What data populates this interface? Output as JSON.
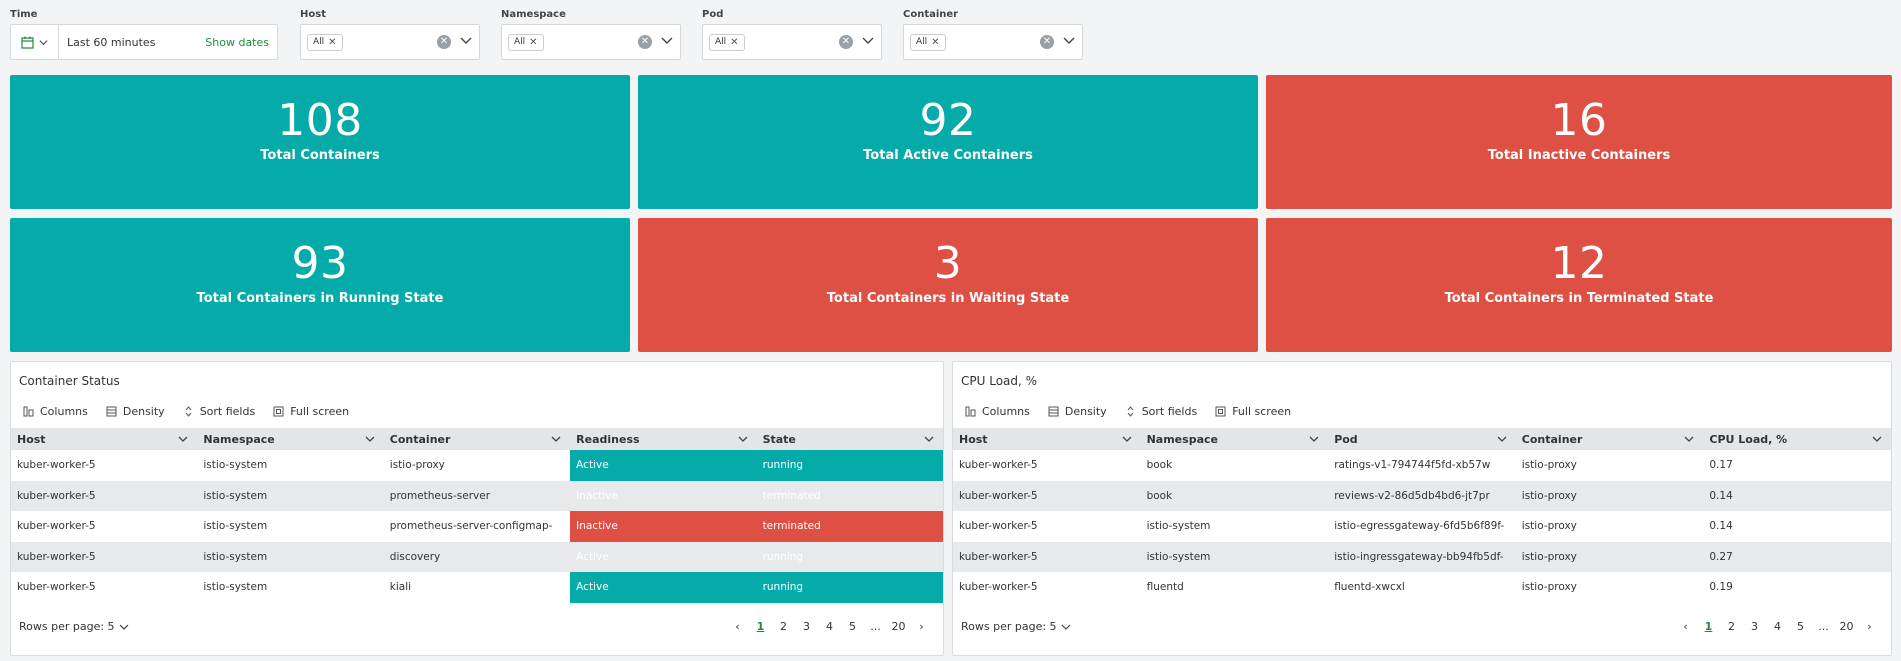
{
  "filters": {
    "time": {
      "label": "Time",
      "value": "Last 60 minutes",
      "action": "Show dates"
    },
    "host": {
      "label": "Host",
      "tag": "All"
    },
    "namespace": {
      "label": "Namespace",
      "tag": "All"
    },
    "pod": {
      "label": "Pod",
      "tag": "All"
    },
    "container": {
      "label": "Container",
      "tag": "All"
    }
  },
  "tiles": [
    {
      "value": "108",
      "label": "Total Containers",
      "color": "#05aba9"
    },
    {
      "value": "92",
      "label": "Total Active Containers",
      "color": "#05aba9"
    },
    {
      "value": "16",
      "label": "Total Inactive Containers",
      "color": "#de4f44"
    },
    {
      "value": "93",
      "label": "Total Containers in Running State",
      "color": "#05aba9"
    },
    {
      "value": "3",
      "label": "Total Containers in Waiting State",
      "color": "#de4f44"
    },
    {
      "value": "12",
      "label": "Total Containers in Terminated State",
      "color": "#de4f44"
    }
  ],
  "toolbar": {
    "columns": "Columns",
    "density": "Density",
    "sort": "Sort fields",
    "fullscreen": "Full screen"
  },
  "container_status": {
    "title": "Container Status",
    "columns": [
      "Host",
      "Namespace",
      "Container",
      "Readiness",
      "State"
    ],
    "rows": [
      [
        "kuber-worker-5",
        "istio-system",
        "istio-proxy",
        "Active",
        "running"
      ],
      [
        "kuber-worker-5",
        "istio-system",
        "prometheus-server",
        "Inactive",
        "terminated"
      ],
      [
        "kuber-worker-5",
        "istio-system",
        "prometheus-server-configmap-",
        "Inactive",
        "terminated"
      ],
      [
        "kuber-worker-5",
        "istio-system",
        "discovery",
        "Active",
        "running"
      ],
      [
        "kuber-worker-5",
        "istio-system",
        "kiali",
        "Active",
        "running"
      ]
    ],
    "rows_per_page": "Rows per page: 5",
    "pages": [
      "1",
      "2",
      "3",
      "4",
      "5",
      "...",
      "20"
    ],
    "current_page": "1"
  },
  "cpu_load": {
    "title": "CPU Load, %",
    "columns": [
      "Host",
      "Namespace",
      "Pod",
      "Container",
      "CPU Load, %"
    ],
    "rows": [
      [
        "kuber-worker-5",
        "book",
        "ratings-v1-794744f5fd-xb57w",
        "istio-proxy",
        "0.17"
      ],
      [
        "kuber-worker-5",
        "book",
        "reviews-v2-86d5db4bd6-jt7pr",
        "istio-proxy",
        "0.14"
      ],
      [
        "kuber-worker-5",
        "istio-system",
        "istio-egressgateway-6fd5b6f89f-",
        "istio-proxy",
        "0.14"
      ],
      [
        "kuber-worker-5",
        "istio-system",
        "istio-ingressgateway-bb94fb5df-",
        "istio-proxy",
        "0.27"
      ],
      [
        "kuber-worker-5",
        "fluentd",
        "fluentd-xwcxl",
        "istio-proxy",
        "0.19"
      ]
    ],
    "rows_per_page": "Rows per page: 5",
    "pages": [
      "1",
      "2",
      "3",
      "4",
      "5",
      "...",
      "20"
    ],
    "current_page": "1"
  },
  "colors": {
    "active": "#05aba9",
    "inactive": "#de4f44",
    "accent": "#1f8a3c"
  }
}
